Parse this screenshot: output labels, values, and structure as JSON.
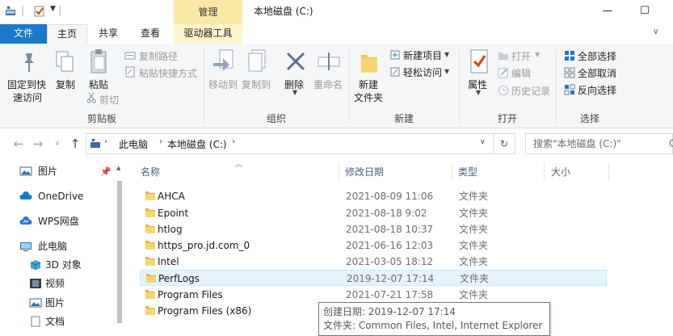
{
  "window": {
    "title": "本地磁盘 (C:)",
    "contextual_tab_header": "管理",
    "controls": {
      "minimize": "—",
      "maximize": "☐"
    }
  },
  "tabs": [
    {
      "label": "文件",
      "active": false
    },
    {
      "label": "主页",
      "active": true
    },
    {
      "label": "共享",
      "active": false
    },
    {
      "label": "查看",
      "active": false
    },
    {
      "label": "驱动器工具",
      "active": false
    }
  ],
  "ribbon": {
    "clipboard": {
      "group": "剪贴板",
      "pin_line1": "固定到快",
      "pin_line2": "速访问",
      "copy": "复制",
      "paste": "粘贴",
      "copy_path": "复制路径",
      "paste_shortcut": "粘贴快捷方式",
      "cut": "剪切"
    },
    "organize": {
      "group": "组织",
      "move_to": "移动到",
      "copy_to": "复制到",
      "delete": "删除",
      "rename": "重命名"
    },
    "new": {
      "group": "新建",
      "new_folder_line1": "新建",
      "new_folder_line2": "文件夹",
      "new_item": "新建项目",
      "easy_access": "轻松访问"
    },
    "open": {
      "group": "打开",
      "properties": "属性",
      "open": "打开",
      "edit": "编辑",
      "history": "历史记录"
    },
    "select": {
      "group": "选择",
      "select_all": "全部选择",
      "select_none": "全部取消",
      "invert": "反向选择"
    }
  },
  "address": {
    "crumbs": [
      "此电脑",
      "本地磁盘 (C:)"
    ],
    "search_placeholder": "搜索\"本地磁盘 (C:)\""
  },
  "nav_pane": [
    {
      "label": "图片",
      "icon": "pictures-icon"
    },
    {
      "label": "OneDrive",
      "icon": "cloud-icon"
    },
    {
      "label": "WPS网盘",
      "icon": "wps-cloud-icon"
    },
    {
      "label": "此电脑",
      "icon": "computer-icon"
    },
    {
      "label": "3D 对象",
      "icon": "3d-objects-icon"
    },
    {
      "label": "视频",
      "icon": "video-icon"
    },
    {
      "label": "图片",
      "icon": "pictures-icon"
    },
    {
      "label": "文档",
      "icon": "documents-icon"
    }
  ],
  "columns": {
    "name": "名称",
    "date": "修改日期",
    "type": "类型",
    "size": "大小"
  },
  "files": [
    {
      "name": "AHCA",
      "date": "2021-08-09 11:06",
      "type": "文件夹"
    },
    {
      "name": "Epoint",
      "date": "2021-08-18 9:02",
      "type": "文件夹"
    },
    {
      "name": "htlog",
      "date": "2021-08-18 10:37",
      "type": "文件夹"
    },
    {
      "name": "https_pro.jd.com_0",
      "date": "2021-06-16 12:03",
      "type": "文件夹"
    },
    {
      "name": "Intel",
      "date": "2021-03-05 18:12",
      "type": "文件夹"
    },
    {
      "name": "PerfLogs",
      "date": "2019-12-07 17:14",
      "type": "文件夹"
    },
    {
      "name": "Program Files",
      "date": "2021-07-21 17:58",
      "type": "文件夹"
    },
    {
      "name": "Program Files (x86)",
      "date": "",
      "type": ""
    }
  ],
  "tooltip": {
    "line1": "创建日期: 2019-12-07 17:14",
    "line2": "文件夹: Common Files, Intel, Internet Explorer"
  },
  "colors": {
    "accent": "#1979ca",
    "folder": "#f3c34c",
    "hover": "#e5f3ff",
    "manage": "#f9e9a5"
  }
}
